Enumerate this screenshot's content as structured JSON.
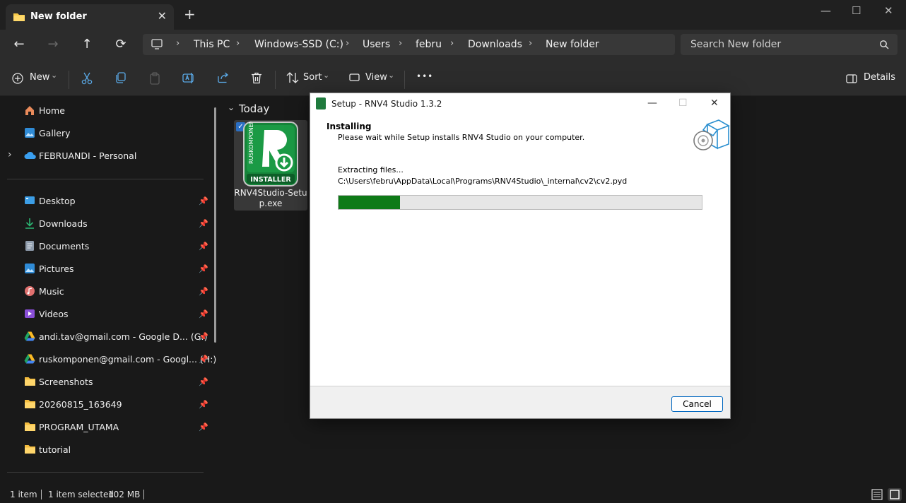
{
  "tab": {
    "title": "New folder",
    "close": "✕",
    "new_tab": "+"
  },
  "window_controls": {
    "minimize": "—",
    "maximize": "☐",
    "close": "✕"
  },
  "nav": {
    "back": "←",
    "forward": "→",
    "up": "↑",
    "refresh": "⟳"
  },
  "breadcrumb": [
    "This PC",
    "Windows-SSD (C:)",
    "Users",
    "febru",
    "Downloads",
    "New folder"
  ],
  "breadcrumb_sep": "›",
  "search": {
    "placeholder": "Search New folder"
  },
  "toolbar": {
    "new_label": "New",
    "sort_label": "Sort",
    "view_label": "View",
    "more_label": "•••",
    "details_label": "Details",
    "dropdown": "⌄"
  },
  "sidebar": {
    "expand": "›",
    "top": [
      {
        "label": "Home",
        "icon": "home-icon"
      },
      {
        "label": "Gallery",
        "icon": "gallery-icon"
      },
      {
        "label": "FEBRUANDI - Personal",
        "icon": "onedrive-icon"
      }
    ],
    "pinned": [
      {
        "label": "Desktop",
        "icon": "desktop-icon"
      },
      {
        "label": "Downloads",
        "icon": "downloads-icon"
      },
      {
        "label": "Documents",
        "icon": "documents-icon"
      },
      {
        "label": "Pictures",
        "icon": "pictures-icon"
      },
      {
        "label": "Music",
        "icon": "music-icon"
      },
      {
        "label": "Videos",
        "icon": "videos-icon"
      },
      {
        "label": "andi.tav@gmail.com - Google D... (G:)",
        "icon": "google-drive-icon"
      },
      {
        "label": "ruskomponen@gmail.com - Googl... (H:)",
        "icon": "google-drive-icon"
      },
      {
        "label": "Screenshots",
        "icon": "folder-icon"
      },
      {
        "label": "20260815_163649",
        "icon": "folder-icon"
      },
      {
        "label": "PROGRAM_UTAMA",
        "icon": "folder-icon"
      },
      {
        "label": "tutorial",
        "icon": "folder-icon"
      }
    ],
    "pin_glyph": "📌"
  },
  "content": {
    "group_label": "Today",
    "group_chevron": "⌄",
    "file": {
      "name": "RNV4Studio-Setup.exe",
      "name_line1": "RNV4Studio-Setu",
      "name_line2": "p.exe",
      "icon_text": "INSTALLER",
      "icon_vertical_text": "RUSKOMPONEN"
    }
  },
  "status": {
    "items": "1 item",
    "selected": "1 item selected",
    "size": "102 MB"
  },
  "dialog": {
    "title": "Setup - RNV4 Studio 1.3.2",
    "heading": "Installing",
    "subheading": "Please wait while Setup installs RNV4 Studio on your computer.",
    "status_line": "Extracting files...",
    "path_line": "C:\\Users\\febru\\AppData\\Local\\Programs\\RNV4Studio\\_internal\\cv2\\cv2.pyd",
    "progress": 0.17,
    "cancel_label": "Cancel",
    "progress_color": "#0e7a17"
  }
}
